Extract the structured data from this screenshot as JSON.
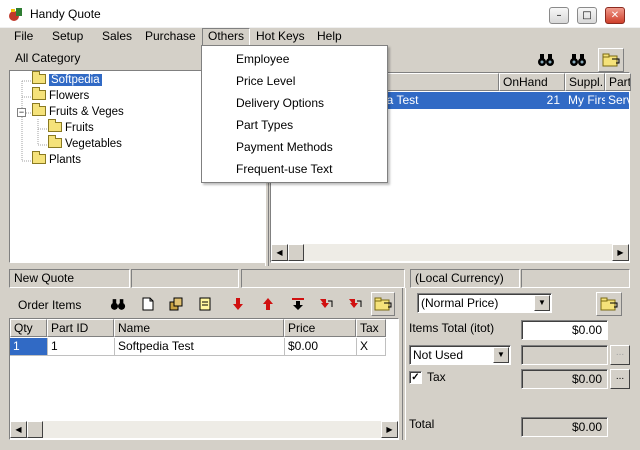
{
  "window": {
    "title": "Handy Quote",
    "minimize_glyph": "–",
    "maximize_glyph": "□",
    "close_glyph": "✕"
  },
  "menubar": {
    "items": [
      "File",
      "Setup",
      "Sales",
      "Purchase",
      "Others",
      "Hot Keys",
      "Help"
    ]
  },
  "others_menu": {
    "items": [
      "Employee",
      "Price Level",
      "Delivery Options",
      "Part Types",
      "Payment Methods",
      "Frequent-use Text"
    ]
  },
  "category_panel": {
    "header": "All Category",
    "tree": [
      {
        "label": "Softpedia",
        "selected": true
      },
      {
        "label": "Flowers"
      },
      {
        "label": "Fruits & Veges",
        "expander": "−"
      },
      {
        "label": "Fruits"
      },
      {
        "label": "Vegetables"
      },
      {
        "label": "Plants"
      }
    ]
  },
  "parts_grid": {
    "columns": [
      "",
      "OnHand",
      "Suppl...",
      "Part"
    ],
    "rows": [
      {
        "name": "ia Test",
        "onhand": "21",
        "supplier": "My First",
        "part": "Serv"
      }
    ]
  },
  "status_row": {
    "new_quote": "New Quote",
    "currency": "(Local Currency)"
  },
  "order_items": {
    "label": "Order Items",
    "columns": [
      "Qty",
      "Part ID",
      "Name",
      "Price",
      "Tax"
    ],
    "rows": [
      {
        "qty": "1",
        "part_id": "1",
        "name": "Softpedia Test",
        "price": "$0.00",
        "tax": "X"
      }
    ]
  },
  "totals": {
    "price_level": "(Normal Price)",
    "items_total_label": "Items Total (itot)",
    "items_total_value": "$0.00",
    "delivery": "Not Used",
    "ellipsis": "...",
    "tax_label": "Tax",
    "tax_checked": "✓",
    "tax_value": "$0.00",
    "total_label": "Total",
    "total_value": "$0.00"
  },
  "colors": {
    "selection": "#316ac5",
    "window_face": "#d4d0c8"
  }
}
